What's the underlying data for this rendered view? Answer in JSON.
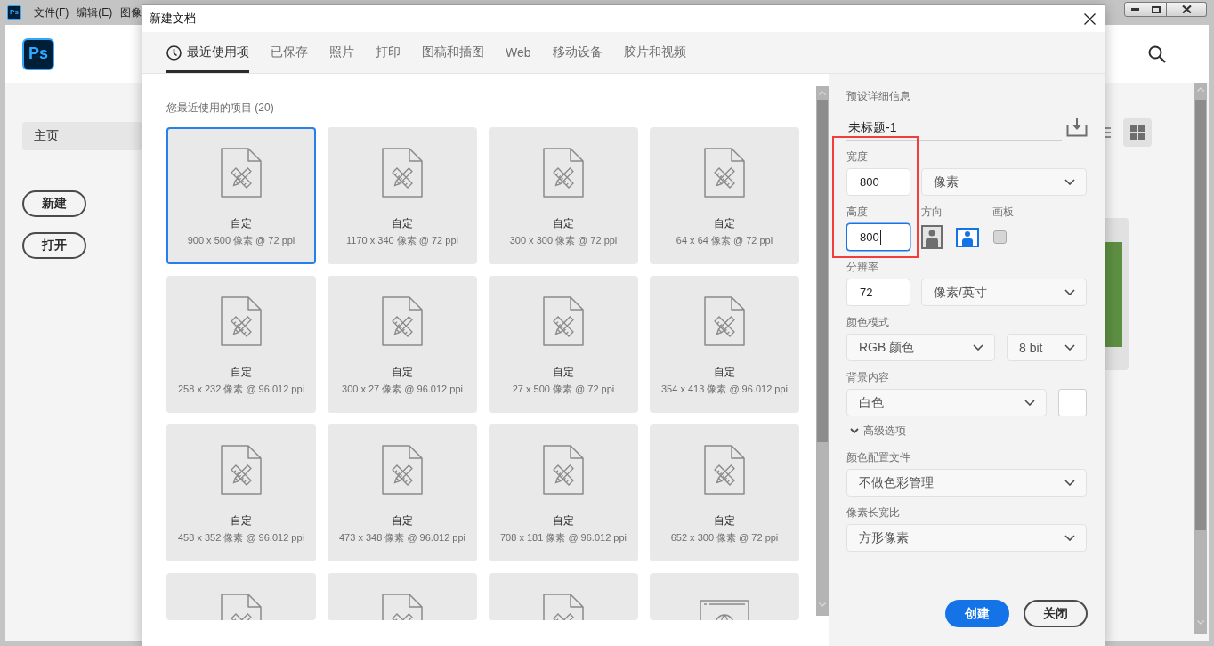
{
  "title_bar": {
    "icon_text": "Ps",
    "menu": [
      "文件(F)",
      "编辑(E)",
      "图像"
    ]
  },
  "home": {
    "logo_text": "Ps",
    "sidebar": [
      {
        "label": "主页",
        "selected": true
      }
    ],
    "buttons": [
      "新建",
      "打开"
    ],
    "view_modes": [
      {
        "kind": "list",
        "selected": false
      },
      {
        "kind": "grid",
        "selected": true
      }
    ]
  },
  "dialog": {
    "title": "新建文档",
    "tabs": [
      {
        "label": "最近使用项",
        "kind": "recent",
        "selected": true
      },
      {
        "label": "已保存",
        "kind": "category",
        "selected": false
      },
      {
        "label": "照片",
        "kind": "category",
        "selected": false
      },
      {
        "label": "打印",
        "kind": "category",
        "selected": false
      },
      {
        "label": "图稿和插图",
        "kind": "category",
        "selected": false
      },
      {
        "label": "Web",
        "kind": "category",
        "selected": false
      },
      {
        "label": "移动设备",
        "kind": "category",
        "selected": false
      },
      {
        "label": "胶片和视频",
        "kind": "category",
        "selected": false
      }
    ],
    "section_title": "您最近使用的项目 (20)",
    "presets": [
      {
        "kind": "document",
        "name": "自定",
        "size": "900 x 500 像素 @ 72 ppi",
        "selected": true
      },
      {
        "kind": "document",
        "name": "自定",
        "size": "1170 x 340 像素 @ 72 ppi",
        "selected": false
      },
      {
        "kind": "document",
        "name": "自定",
        "size": "300 x 300 像素 @ 72 ppi",
        "selected": false
      },
      {
        "kind": "document",
        "name": "自定",
        "size": "64 x 64 像素 @ 72 ppi",
        "selected": false
      },
      {
        "kind": "document",
        "name": "自定",
        "size": "258 x 232 像素 @ 96.012 ppi",
        "selected": false
      },
      {
        "kind": "document",
        "name": "自定",
        "size": "300 x 27 像素 @ 96.012 ppi",
        "selected": false
      },
      {
        "kind": "document",
        "name": "自定",
        "size": "27 x 500 像素 @ 72 ppi",
        "selected": false
      },
      {
        "kind": "document",
        "name": "自定",
        "size": "354 x 413 像素 @ 96.012 ppi",
        "selected": false
      },
      {
        "kind": "document",
        "name": "自定",
        "size": "458 x 352 像素 @ 96.012 ppi",
        "selected": false
      },
      {
        "kind": "document",
        "name": "自定",
        "size": "473 x 348 像素 @ 96.012 ppi",
        "selected": false
      },
      {
        "kind": "document",
        "name": "自定",
        "size": "708 x 181 像素 @ 96.012 ppi",
        "selected": false
      },
      {
        "kind": "document",
        "name": "自定",
        "size": "652 x 300 像素 @ 72 ppi",
        "selected": false
      },
      {
        "kind": "document",
        "selected": false
      },
      {
        "kind": "document",
        "selected": false
      },
      {
        "kind": "document",
        "selected": false
      },
      {
        "kind": "web",
        "selected": false
      }
    ],
    "details": {
      "heading": "预设详细信息",
      "name": "未标题-1",
      "width": {
        "label": "宽度",
        "value": "800",
        "focused": false,
        "unit": "像素"
      },
      "height": {
        "label": "高度",
        "value": "800",
        "focused": true
      },
      "orientation": {
        "label": "方向",
        "options": [
          {
            "kind": "portrait",
            "selected": false
          },
          {
            "kind": "landscape",
            "selected": true
          }
        ]
      },
      "artboard": {
        "label": "画板",
        "checked": false
      },
      "resolution": {
        "label": "分辨率",
        "value": "72",
        "focused": false,
        "unit": "像素/英寸"
      },
      "color_mode": {
        "label": "颜色模式",
        "mode": "RGB 颜色",
        "depth": "8 bit"
      },
      "background": {
        "label": "背景内容",
        "value": "白色"
      },
      "advanced": {
        "label": "高级选项",
        "expanded": true
      },
      "color_profile": {
        "label": "颜色配置文件",
        "value": "不做色彩管理"
      },
      "pixel_aspect": {
        "label": "像素长宽比",
        "value": "方形像素"
      },
      "buttons": [
        {
          "label": "创建",
          "kind": "create"
        },
        {
          "label": "关闭",
          "kind": "close"
        }
      ]
    }
  }
}
